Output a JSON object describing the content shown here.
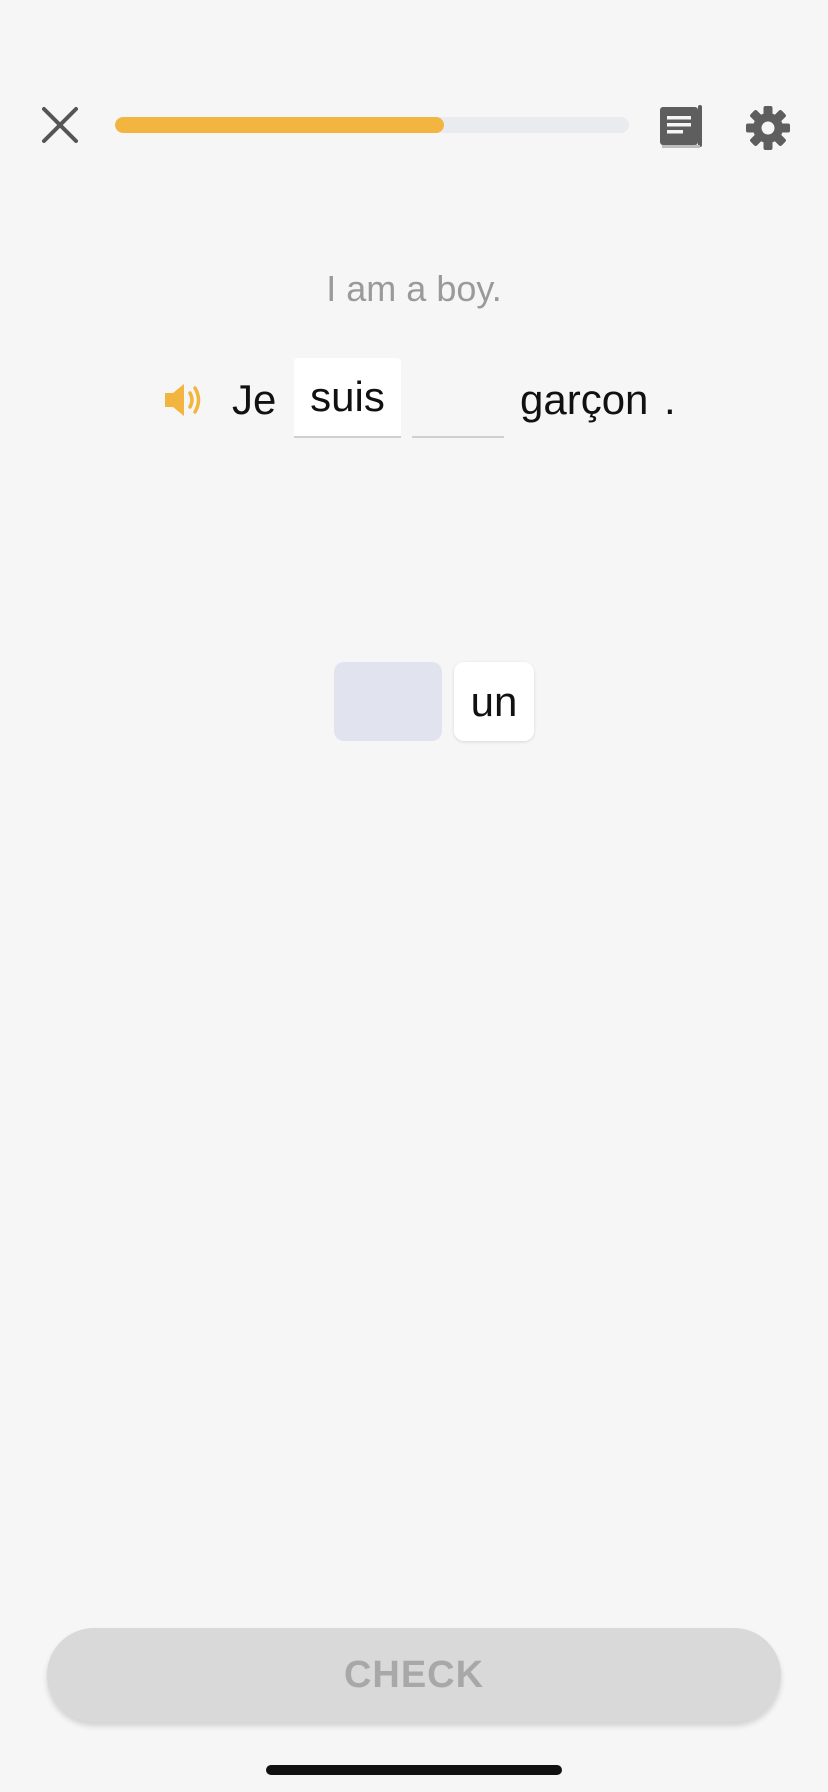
{
  "header": {
    "close_icon": "close-icon",
    "progress_fraction": 0.64,
    "progress_color": "#f2b53f",
    "notes_icon": "notes-icon",
    "settings_icon": "gear-icon"
  },
  "exercise": {
    "prompt": "I am a boy.",
    "speaker_icon": "speaker-icon",
    "speaker_color": "#f2b53f",
    "sentence": {
      "word_1": "Je",
      "slot_1_value": "suis",
      "slot_2_value": "",
      "word_2": "garçon",
      "punctuation": "."
    }
  },
  "word_bank": {
    "tiles": [
      {
        "label": "",
        "used": true
      },
      {
        "label": "un",
        "used": false
      }
    ]
  },
  "footer": {
    "check_label": "CHECK"
  }
}
